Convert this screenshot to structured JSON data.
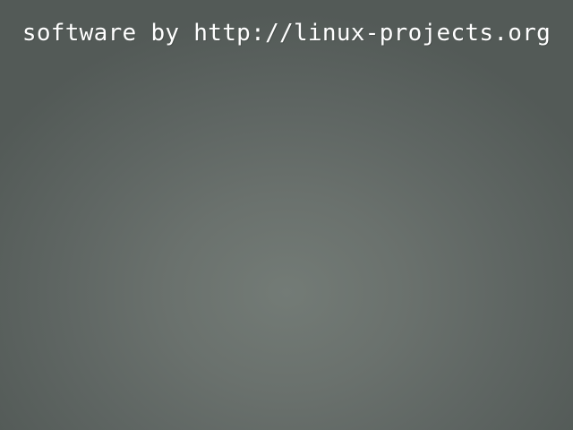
{
  "screen": {
    "credit_text": "software by http://linux-projects.org",
    "background_color": "#6a716d",
    "text_color": "#ffffff"
  }
}
